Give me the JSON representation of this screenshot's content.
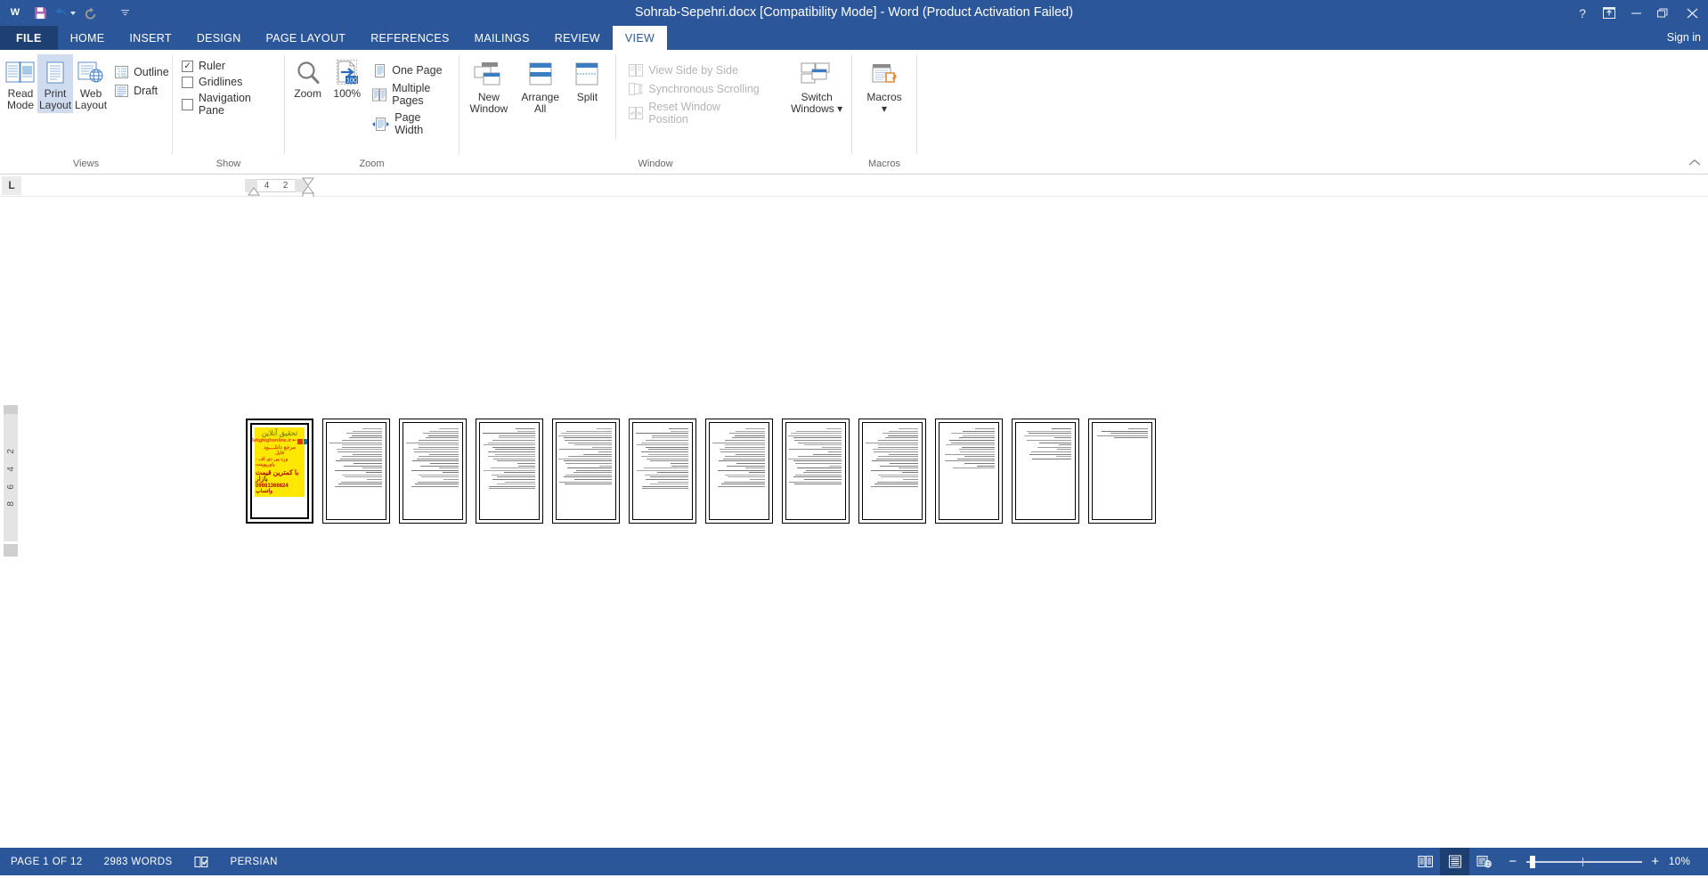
{
  "titlebar": {
    "app_icon": "word-logo-icon",
    "title": "Sohrab-Sepehri.docx [Compatibility Mode] - Word (Product Activation Failed)",
    "qat": [
      {
        "name": "save-icon",
        "label": "Save"
      },
      {
        "name": "undo-icon",
        "label": "Undo"
      },
      {
        "name": "redo-icon",
        "label": "Redo"
      },
      {
        "name": "customize-qat-icon",
        "label": "Customize Quick Access Toolbar"
      }
    ],
    "help_label": "?",
    "ribbon_display_label": "Ribbon Display Options",
    "minimize_label": "Minimize",
    "restore_label": "Restore Down",
    "close_label": "Close"
  },
  "tabs": {
    "file": "FILE",
    "items": [
      {
        "label": "HOME",
        "active": false
      },
      {
        "label": "INSERT",
        "active": false
      },
      {
        "label": "DESIGN",
        "active": false
      },
      {
        "label": "PAGE LAYOUT",
        "active": false
      },
      {
        "label": "REFERENCES",
        "active": false
      },
      {
        "label": "MAILINGS",
        "active": false
      },
      {
        "label": "REVIEW",
        "active": false
      },
      {
        "label": "VIEW",
        "active": true
      }
    ],
    "signin": "Sign in"
  },
  "ribbon": {
    "collapse_label": "Collapse the Ribbon",
    "groups": {
      "views": {
        "label": "Views",
        "buttons": [
          {
            "name": "read-mode-button",
            "line1": "Read",
            "line2": "Mode",
            "selected": false
          },
          {
            "name": "print-layout-button",
            "line1": "Print",
            "line2": "Layout",
            "selected": true
          },
          {
            "name": "web-layout-button",
            "line1": "Web",
            "line2": "Layout",
            "selected": false
          }
        ],
        "small": [
          {
            "name": "outline-button",
            "label": "Outline"
          },
          {
            "name": "draft-button",
            "label": "Draft"
          }
        ]
      },
      "show": {
        "label": "Show",
        "checkboxes": [
          {
            "name": "ruler-checkbox",
            "label": "Ruler",
            "checked": true
          },
          {
            "name": "gridlines-checkbox",
            "label": "Gridlines",
            "checked": false
          },
          {
            "name": "navigation-pane-checkbox",
            "label": "Navigation Pane",
            "checked": false
          }
        ]
      },
      "zoom": {
        "label": "Zoom",
        "buttons": [
          {
            "name": "zoom-button",
            "label": "Zoom"
          },
          {
            "name": "zoom-100-button",
            "label": "100%",
            "badge": "100"
          }
        ],
        "small": [
          {
            "name": "one-page-button",
            "label": "One Page"
          },
          {
            "name": "multiple-pages-button",
            "label": "Multiple Pages"
          },
          {
            "name": "page-width-button",
            "label": "Page Width"
          }
        ]
      },
      "window": {
        "label": "Window",
        "buttons": [
          {
            "name": "new-window-button",
            "line1": "New",
            "line2": "Window"
          },
          {
            "name": "arrange-all-button",
            "line1": "Arrange",
            "line2": "All"
          },
          {
            "name": "split-button",
            "line1": "Split",
            "line2": ""
          }
        ],
        "small": [
          {
            "name": "view-side-by-side-button",
            "label": "View Side by Side",
            "disabled": true
          },
          {
            "name": "synchronous-scrolling-button",
            "label": "Synchronous Scrolling",
            "disabled": true
          },
          {
            "name": "reset-window-position-button",
            "label": "Reset Window Position",
            "disabled": true
          }
        ],
        "switch_windows": {
          "name": "switch-windows-button",
          "line1": "Switch",
          "line2": "Windows"
        }
      },
      "macros": {
        "label": "Macros",
        "button": {
          "name": "macros-button",
          "line1": "Macros",
          "line2": ""
        }
      }
    }
  },
  "ruler": {
    "tab_stop_marker": "L",
    "marks": [
      "4",
      "2"
    ]
  },
  "vertical_ruler": {
    "marks": [
      "2",
      "4",
      "6",
      "8"
    ]
  },
  "document": {
    "page_count": 12,
    "cover": {
      "line1": "تحقیق آنلاین",
      "line2": "Tahghighonline.ir",
      "line3": "مرجع دانلــــود",
      "line4": "فایل",
      "line5": "ورد-پی دی اف - پاورپوینت",
      "line6": "با کمترین قیمت بازار",
      "line7": "09981366624 واتساپ"
    },
    "pages": [
      {
        "index": 1,
        "type": "cover"
      },
      {
        "index": 2,
        "type": "text",
        "lines": 26
      },
      {
        "index": 3,
        "type": "text",
        "lines": 26
      },
      {
        "index": 4,
        "type": "text",
        "lines": 27
      },
      {
        "index": 5,
        "type": "text",
        "lines": 25
      },
      {
        "index": 6,
        "type": "text",
        "lines": 27
      },
      {
        "index": 7,
        "type": "text",
        "lines": 26
      },
      {
        "index": 8,
        "type": "text",
        "lines": 25
      },
      {
        "index": 9,
        "type": "text",
        "lines": 26
      },
      {
        "index": 10,
        "type": "text",
        "lines": 18
      },
      {
        "index": 11,
        "type": "text",
        "lines": 14
      },
      {
        "index": 12,
        "type": "text",
        "lines": 5
      }
    ]
  },
  "statusbar": {
    "page_status": "PAGE 1 OF 12",
    "word_count": "2983 WORDS",
    "proofing_icon": "proofing-errors-icon",
    "language": "PERSIAN",
    "views": [
      {
        "name": "read-mode-view-button",
        "label": "Read Mode",
        "active": false
      },
      {
        "name": "print-layout-view-button",
        "label": "Print Layout",
        "active": true
      },
      {
        "name": "web-layout-view-button",
        "label": "Web Layout",
        "active": false
      }
    ],
    "zoom_out_label": "−",
    "zoom_in_label": "+",
    "zoom_level": "10%"
  }
}
